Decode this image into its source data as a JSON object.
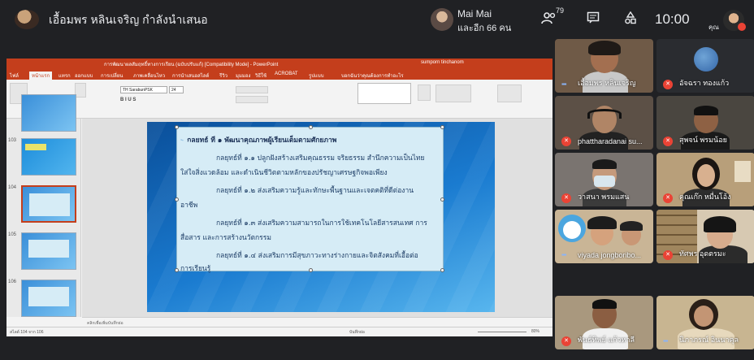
{
  "header": {
    "presenter_title": "เอื้อมพร หลินเจริญ กำลังนำเสนอ",
    "user_name": "Mai Mai",
    "user_sub": "และอีก 66 คน",
    "participant_count": "79",
    "clock": "10:00",
    "me_label": "คุณ"
  },
  "powerpoint": {
    "window_title": "การพัฒนาผลสัมฤทธิ์ทางการเรียน (ฉบับปรับแก้)  [Compatibility Mode] - PowerPoint",
    "account": "sumporn tinchanom",
    "tabs": [
      "ไฟล์",
      "หน้าแรก",
      "แทรก",
      "ออกแบบ",
      "การเปลี่ยน",
      "ภาพเคลื่อนไหว",
      "การนำเสนอสไลด์",
      "รีวิว",
      "มุมมอง",
      "วิธีใช้",
      "ACROBAT",
      "รูปแบบ",
      "บอกฉันว่าคุณต้องการทำอะไร"
    ],
    "font_name": "TH SarabunPSK",
    "font_size": "24",
    "slide_numbers": [
      "103",
      "104",
      "105",
      "106"
    ],
    "slide_lines": [
      "กลยุทธ์ ที่ ๑ พัฒนาคุณภาพผู้เรียนเต็มตามศักยภาพ",
      "กลยุทธ์ที่ ๑.๑ ปลูกฝังสร้างเสริมคุณธรรม จริยธรรม สำนึกความเป็นไทย",
      "ใส่ใจสิ่งแวดล้อม และดำเนินชีวิตตามหลักของปรัชญาเศรษฐกิจพอเพียง",
      "กลยุทธ์ที่ ๑.๒ ส่งเสริมความรู้และทักษะพื้นฐานและเจตคติที่ดีต่องาน",
      "อาชีพ",
      "กลยุทธ์ที่ ๑.๓ ส่งเสริมความสามารถในการใช้เทคโนโลยีสารสนเทศ การ",
      "สื่อสาร และการสร้างนวัตกรรม",
      "กลยุทธ์ที่ ๑.๔ ส่งเสริมการมีสุขภาวะทางร่างกายและจิตสังคมที่เอื้อต่อ",
      "การเรียนรู้"
    ],
    "notes_placeholder": "คลิกเพื่อเพิ่มบันทึกย่อ",
    "status_slide": "สไลด์ 104 จาก 106",
    "status_notes": "บันทึกย่อ",
    "status_zoom": "80%"
  },
  "participants": [
    {
      "name": "เอื้อมพร หลินเจริญ",
      "muted": false
    },
    {
      "name": "อัจฉรา ทองแก้ว",
      "muted": true
    },
    {
      "name": "phattharadanai su...",
      "muted": true
    },
    {
      "name": "สุพจน์ พรมน้อย",
      "muted": true
    },
    {
      "name": "วาสนา พรมแสน",
      "muted": true
    },
    {
      "name": "คุณเก๊ก หมื่นโอ้ง",
      "muted": true
    },
    {
      "name": "viyada jongboribo...",
      "muted": false
    },
    {
      "name": "ทัศพร อุดตรมะ",
      "muted": true
    },
    {
      "name": "พันธ์ทิพย์ แก้วหาลี",
      "muted": true
    },
    {
      "name": "นิภาภรณ์ อินนาคุล",
      "muted": false
    }
  ],
  "colors": {
    "meet_bg": "#202124",
    "ppt_accent": "#c43e1c",
    "mic_off": "#ea4335"
  }
}
